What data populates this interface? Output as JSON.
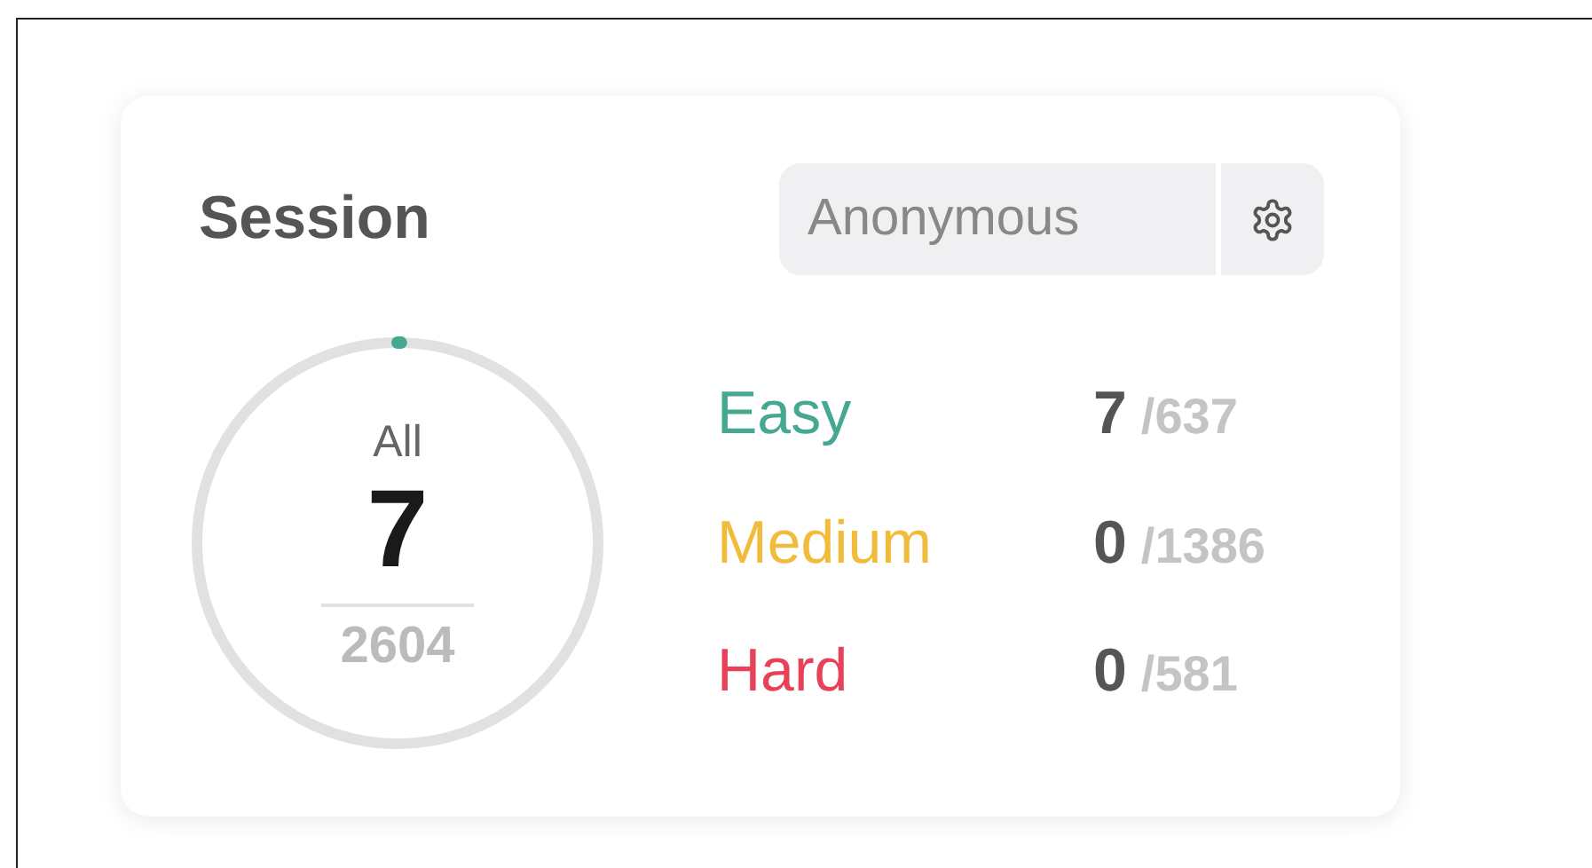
{
  "session": {
    "title": "Session",
    "user_field": {
      "value": "Anonymous"
    },
    "total": {
      "label": "All",
      "solved": "7",
      "count": "2604",
      "level": 0.0027
    },
    "difficulties": [
      {
        "label": "Easy",
        "color": "#46a891",
        "solved": "7",
        "total": "/637"
      },
      {
        "label": "Medium",
        "color": "#f1bb3b",
        "solved": "0",
        "total": "/1386"
      },
      {
        "label": "Hard",
        "color": "#e8415a",
        "solved": "0",
        "total": "/581"
      }
    ]
  }
}
